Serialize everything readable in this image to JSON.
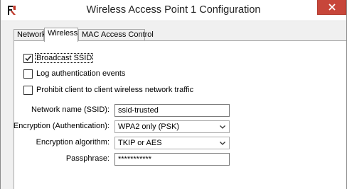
{
  "window": {
    "title": "Wireless Access Point 1 Configuration",
    "app_icon": "firebox-logo-icon",
    "close_icon": "close-icon",
    "close_color": "#c7463a"
  },
  "tabs": [
    {
      "label": "Network",
      "active": false
    },
    {
      "label": "Wireless",
      "active": true
    },
    {
      "label": "MAC Access Control",
      "active": false
    }
  ],
  "checkboxes": {
    "broadcast_ssid": {
      "label": "Broadcast SSID",
      "checked": true
    },
    "log_auth": {
      "label": "Log authentication events",
      "checked": false
    },
    "prohibit_c2c": {
      "label": "Prohibit client to client wireless network traffic",
      "checked": false
    }
  },
  "fields": {
    "network_name": {
      "label": "Network name (SSID):",
      "value": "ssid-trusted"
    },
    "encryption_auth": {
      "label": "Encryption (Authentication):",
      "value": "WPA2 only (PSK)"
    },
    "encryption_alg": {
      "label": "Encryption algorithm:",
      "value": "TKIP or AES"
    },
    "passphrase": {
      "label": "Passphrase:",
      "value": "***********"
    }
  }
}
